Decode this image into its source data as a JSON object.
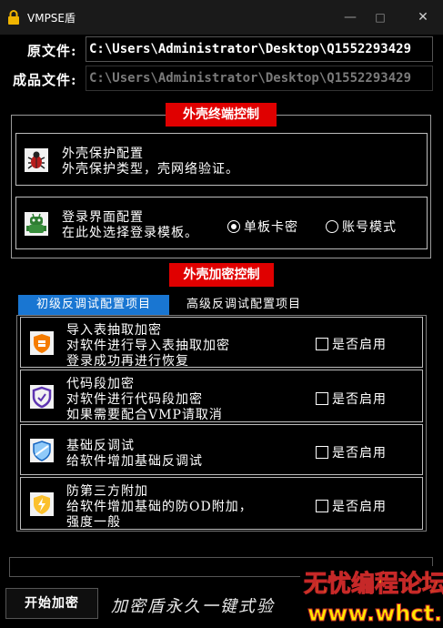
{
  "window": {
    "title": "VMPSE盾",
    "minimize": "—",
    "maximize": "□",
    "close": "✕"
  },
  "fields": {
    "source_label": "原文件:",
    "source_value": "C:\\Users\\Administrator\\Desktop\\Q1552293429",
    "output_label": "成品文件:",
    "output_value": "C:\\Users\\Administrator\\Desktop\\Q1552293429"
  },
  "shell_terminal": {
    "title": "外壳终端控制",
    "protect_card": {
      "icon": "bug-icon",
      "title": "外壳保护配置",
      "desc": "外壳保护类型，壳网络验证。"
    },
    "login_card": {
      "icon": "robot-icon",
      "title": "登录界面配置",
      "desc": "在此处选择登录模板。",
      "options": [
        {
          "label": "单板卡密",
          "selected": true
        },
        {
          "label": "账号模式",
          "selected": false
        }
      ]
    }
  },
  "shell_encrypt": {
    "title": "外壳加密控制",
    "tabs": [
      {
        "label": "初级反调试配置项目",
        "active": true
      },
      {
        "label": "高级反调试配置项目",
        "active": false
      }
    ],
    "items": [
      {
        "icon": "shield-orange-icon",
        "lines": [
          "导入表抽取加密",
          "对软件进行导入表抽取加密",
          "登录成功再进行恢复"
        ],
        "check_label": "是否启用",
        "checked": false
      },
      {
        "icon": "shield-purple-icon",
        "lines": [
          "代码段加密",
          "对软件进行代码段加密",
          "如果需要配合VMP请取消"
        ],
        "check_label": "是否启用",
        "checked": false
      },
      {
        "icon": "shield-blue-icon",
        "lines": [
          "基础反调试",
          "给软件增加基础反调试"
        ],
        "check_label": "是否启用",
        "checked": false
      },
      {
        "icon": "lightning-shield-icon",
        "lines": [
          "防第三方附加",
          "给软件增加基础的防OD附加，",
          "强度一般"
        ],
        "check_label": "是否启用",
        "checked": false
      }
    ]
  },
  "footer": {
    "start_button": "开始加密",
    "status_text": "加密盾永久一键式验",
    "watermark_top": "无忧编程论坛",
    "watermark_bottom": "www.whct.net"
  },
  "colors": {
    "accent_red": "#e00000",
    "tab_blue": "#1976d2",
    "watermark_yellow": "#ffe600"
  }
}
